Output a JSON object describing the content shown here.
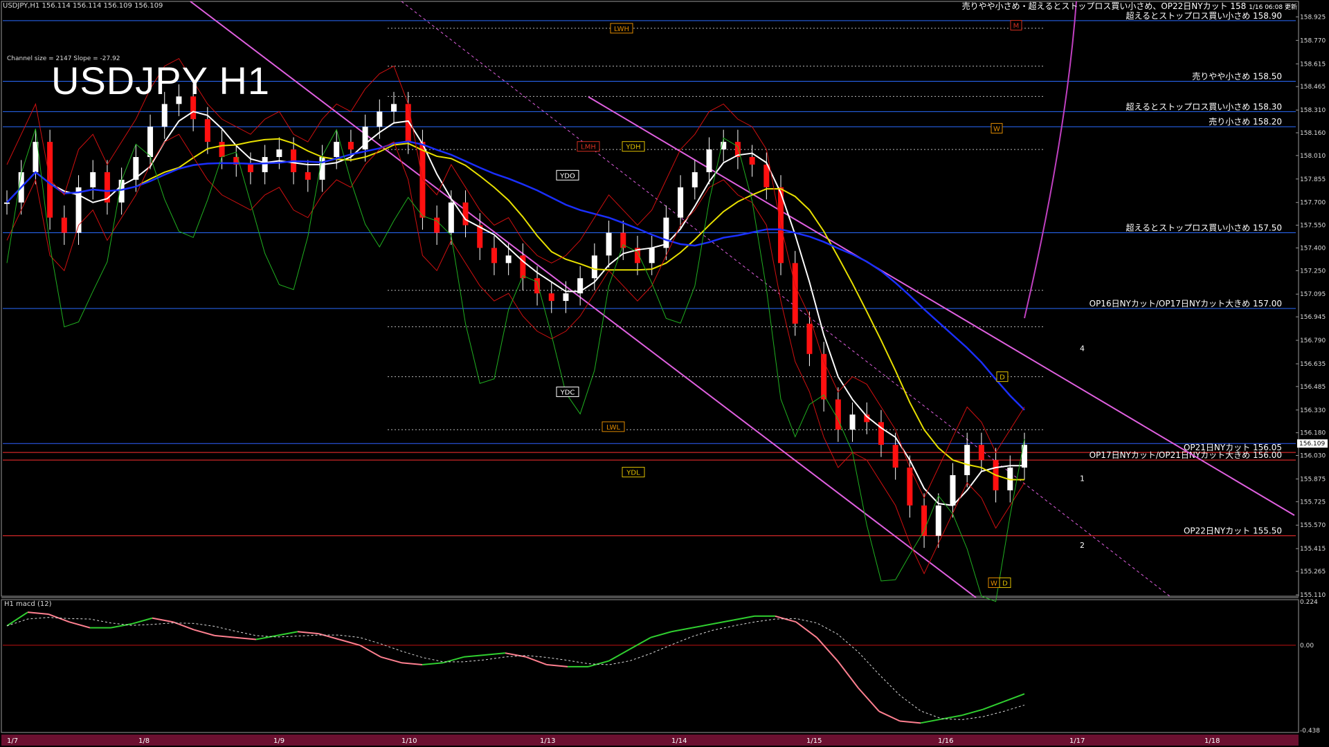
{
  "header": {
    "symbol_line": "USDJPY,H1  156.114 156.114 156.109 156.109",
    "title": "USDJPY H1",
    "channel_info": "Channel size = 2147 Slope = -27.92",
    "macd_label": "H1  macd (12)",
    "top_right_note": "売りやや小さめ・超えるとストップロス買い小さめ、OP22日NYカット 158",
    "timestamp": "1/16 06:08 更新"
  },
  "chart_data": {
    "type": "line",
    "title": "USDJPY H1",
    "price_axis_ticks": [
      "158.925",
      "158.770",
      "158.615",
      "158.465",
      "158.310",
      "158.160",
      "158.010",
      "157.855",
      "157.700",
      "157.550",
      "157.400",
      "157.250",
      "157.095",
      "156.945",
      "156.790",
      "156.635",
      "156.485",
      "156.330",
      "156.180",
      "156.030",
      "155.875",
      "155.725",
      "155.570",
      "155.415",
      "155.265",
      "155.110"
    ],
    "ylim": [
      155.11,
      159.0
    ],
    "current_price": "156.109",
    "date_labels": [
      "1/7",
      "1/8",
      "1/9",
      "1/10",
      "1/13",
      "1/14",
      "1/15",
      "1/16",
      "1/17",
      "1/18"
    ],
    "macd_axis_ticks": [
      "0.224",
      "0.00",
      "-0.438"
    ],
    "macd_ylim": [
      -0.438,
      0.224
    ],
    "levels": [
      {
        "label": "超えるとストップロス買い小さめ 158.90",
        "value": 158.9,
        "color": "#2a6bff"
      },
      {
        "label": "売りやや小さめ 158.50",
        "value": 158.5,
        "color": "#2a6bff"
      },
      {
        "label": "超えるとストップロス買い小さめ 158.30",
        "value": 158.3,
        "color": "#2a6bff"
      },
      {
        "label": "売り小さめ 158.20",
        "value": 158.2,
        "color": "#2a6bff"
      },
      {
        "label": "超えるとストップロス買い小さめ 157.50",
        "value": 157.5,
        "color": "#2a6bff"
      },
      {
        "label": "OP16日NYカット/OP17日NYカット大きめ 157.00",
        "value": 157.0,
        "color": "#2a6bff"
      },
      {
        "label": "OP21日NYカット 156.05",
        "value": 156.05,
        "color": "#ff3030"
      },
      {
        "label": "OP17日NYカット/OP21日NYカット大きめ 156.00",
        "value": 156.0,
        "color": "#ff3030"
      },
      {
        "label": "OP22日NYカット 155.50",
        "value": 155.5,
        "color": "#ff3030"
      }
    ],
    "tags": [
      {
        "label": "LWH",
        "value": 158.85,
        "color": "#e08a00"
      },
      {
        "label": "YDH",
        "value": 158.07,
        "color": "#e0c000"
      },
      {
        "label": "LMH",
        "value": 158.07,
        "color": "#d03020"
      },
      {
        "label": "YDO",
        "value": 157.88,
        "color": "#ffffff"
      },
      {
        "label": "YDC",
        "value": 156.45,
        "color": "#ffffff"
      },
      {
        "label": "LWL",
        "value": 156.22,
        "color": "#e08a00"
      },
      {
        "label": "YDL",
        "value": 155.92,
        "color": "#e0c000"
      },
      {
        "label": "W",
        "value": 158.19,
        "color": "#e08a00"
      },
      {
        "label": "D",
        "value": 156.55,
        "color": "#e0c000"
      },
      {
        "label": "M",
        "value": 155.19,
        "color": "#d03020"
      },
      {
        "label": "W",
        "value": 155.19,
        "color": "#e08a00"
      },
      {
        "label": "D",
        "value": 155.19,
        "color": "#e0c000"
      },
      {
        "label": "M",
        "value": 158.87,
        "color": "#d03020"
      }
    ],
    "projection_labels": [
      {
        "label": "4",
        "value": 156.72
      },
      {
        "label": "1",
        "value": 155.86
      },
      {
        "label": "2",
        "value": 155.42
      }
    ],
    "candles_close": [
      157.7,
      157.9,
      158.1,
      157.6,
      157.5,
      157.8,
      157.9,
      157.7,
      157.85,
      158.0,
      158.2,
      158.35,
      158.4,
      158.25,
      158.1,
      158.0,
      157.95,
      157.9,
      158.0,
      158.05,
      157.9,
      157.85,
      158.0,
      158.1,
      158.05,
      158.2,
      158.3,
      158.35,
      158.1,
      157.6,
      157.5,
      157.7,
      157.55,
      157.4,
      157.3,
      157.35,
      157.2,
      157.1,
      157.05,
      157.1,
      157.2,
      157.35,
      157.5,
      157.4,
      157.3,
      157.4,
      157.6,
      157.8,
      157.9,
      158.05,
      158.1,
      158.0,
      157.95,
      157.8,
      157.3,
      156.9,
      156.7,
      156.4,
      156.2,
      156.3,
      156.25,
      156.1,
      155.95,
      155.7,
      155.5,
      155.7,
      155.9,
      156.1,
      156.0,
      155.8,
      155.95,
      156.1
    ],
    "macd_line": [
      0.1,
      0.17,
      0.16,
      0.12,
      0.09,
      0.09,
      0.11,
      0.14,
      0.12,
      0.08,
      0.05,
      0.04,
      0.03,
      0.05,
      0.07,
      0.06,
      0.03,
      0.0,
      -0.06,
      -0.09,
      -0.1,
      -0.09,
      -0.06,
      -0.05,
      -0.04,
      -0.06,
      -0.1,
      -0.11,
      -0.11,
      -0.08,
      -0.02,
      0.04,
      0.07,
      0.09,
      0.11,
      0.13,
      0.15,
      0.15,
      0.12,
      0.04,
      -0.08,
      -0.22,
      -0.34,
      -0.39,
      -0.4,
      -0.38,
      -0.36,
      -0.33,
      -0.29,
      -0.25
    ],
    "grid": false,
    "legend": "none"
  }
}
